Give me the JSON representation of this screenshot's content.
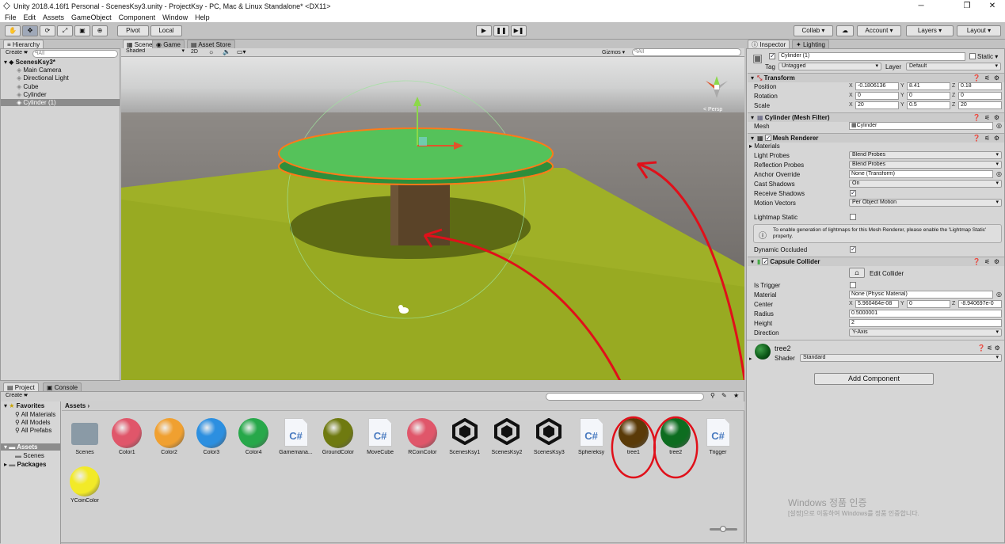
{
  "window": {
    "title": "Unity 2018.4.16f1 Personal - ScenesKsy3.unity - ProjectKsy - PC, Mac & Linux Standalone* <DX11>",
    "min": "─",
    "max": "❐",
    "close": "✕"
  },
  "menu": [
    "File",
    "Edit",
    "Assets",
    "GameObject",
    "Component",
    "Window",
    "Help"
  ],
  "toolbar": {
    "pivot": "Pivot",
    "local": "Local",
    "collab": "Collab ▾",
    "account": "Account ▾",
    "layers": "Layers ▾",
    "layout": "Layout ▾"
  },
  "hierarchy": {
    "tab": "Hierarchy",
    "create": "Create ▾",
    "search": "ᑫAll",
    "scene": "ScenesKsy3*",
    "items": [
      "Main Camera",
      "Directional Light",
      "Cube",
      "Cylinder",
      "Cylinder (1)"
    ]
  },
  "scene": {
    "tabs": [
      "Scene",
      "Game",
      "Asset Store"
    ],
    "shading": "Shaded",
    "mode2d": "2D",
    "gizmos": "Gizmos ▾",
    "search": "ᑫAll",
    "persp": "< Persp"
  },
  "project": {
    "tabs": [
      "Project",
      "Console"
    ],
    "create": "Create ▾",
    "breadcrumb": "Assets ›",
    "favorites": {
      "label": "Favorites",
      "items": [
        "All Materials",
        "All Models",
        "All Prefabs"
      ]
    },
    "tree": {
      "assets": "Assets",
      "scenes": "Scenes",
      "packages": "Packages"
    },
    "assets": [
      {
        "name": "Scenes",
        "kind": "folder"
      },
      {
        "name": "Color1",
        "kind": "sphere",
        "color": "#e0566a"
      },
      {
        "name": "Color2",
        "kind": "sphere",
        "color": "#f0a030"
      },
      {
        "name": "Color3",
        "kind": "sphere",
        "color": "#2c8fe0"
      },
      {
        "name": "Color4",
        "kind": "sphere",
        "color": "#27a84a"
      },
      {
        "name": "Gamemana...",
        "kind": "cs"
      },
      {
        "name": "GroundColor",
        "kind": "sphere",
        "color": "#6f7a10"
      },
      {
        "name": "MoveCube",
        "kind": "cs"
      },
      {
        "name": "RCoinColor",
        "kind": "sphere",
        "color": "#e0566a"
      },
      {
        "name": "ScenesKsy1",
        "kind": "unity"
      },
      {
        "name": "ScenesKsy2",
        "kind": "unity"
      },
      {
        "name": "ScenesKsy3",
        "kind": "unity"
      },
      {
        "name": "Sphereksy",
        "kind": "cs"
      },
      {
        "name": "tree1",
        "kind": "sphere",
        "color": "#5a3a08"
      },
      {
        "name": "tree2",
        "kind": "sphere",
        "color": "#0d6d20"
      },
      {
        "name": "Trigger",
        "kind": "cs"
      },
      {
        "name": "YCoinColor",
        "kind": "sphere",
        "color": "#f2ea28"
      }
    ]
  },
  "inspector": {
    "tabs": [
      "Inspector",
      "Lighting"
    ],
    "object_name": "Cylinder (1)",
    "static": "Static ▾",
    "tag_label": "Tag",
    "tag": "Untagged",
    "layer_label": "Layer",
    "layer": "Default",
    "transform": {
      "title": "Transform",
      "position_label": "Position",
      "rotation_label": "Rotation",
      "scale_label": "Scale",
      "position": [
        "-0.1806136",
        "8.41",
        "0.18"
      ],
      "rotation": [
        "0",
        "0",
        "0"
      ],
      "scale": [
        "20",
        "0.5",
        "20"
      ]
    },
    "mesh_filter": {
      "title": "Cylinder (Mesh Filter)",
      "mesh_label": "Mesh",
      "mesh": "▦Cylinder"
    },
    "mesh_renderer": {
      "title": "Mesh Renderer",
      "materials": "Materials",
      "light_probes_label": "Light Probes",
      "light_probes": "Blend Probes",
      "reflection_label": "Reflection Probes",
      "reflection": "Blend Probes",
      "anchor_label": "Anchor Override",
      "anchor": "None (Transform)",
      "cast_label": "Cast Shadows",
      "cast": "On",
      "receive_label": "Receive Shadows",
      "motion_label": "Motion Vectors",
      "motion": "Per Object Motion",
      "lightmap_label": "Lightmap Static",
      "info": "To enable generation of lightmaps for this Mesh Renderer, please enable the 'Lightmap Static' property.",
      "dynamic_label": "Dynamic Occluded"
    },
    "capsule": {
      "title": "Capsule Collider",
      "edit": "Edit Collider",
      "trigger_label": "Is Trigger",
      "material_label": "Material",
      "material": "None (Physic Material)",
      "center_label": "Center",
      "center": [
        "5.960464e-08",
        "0",
        "-8.940697e-0"
      ],
      "radius_label": "Radius",
      "radius": "0.5000001",
      "height_label": "Height",
      "height": "2",
      "direction_label": "Direction",
      "direction": "Y-Axis"
    },
    "material": {
      "name": "tree2",
      "shader_label": "Shader",
      "shader": "Standard"
    },
    "add_component": "Add Component"
  },
  "watermark": {
    "line1": "Windows 정품 인증",
    "line2": "[설정]으로 이동하여 Windows를 정품 인증합니다."
  }
}
